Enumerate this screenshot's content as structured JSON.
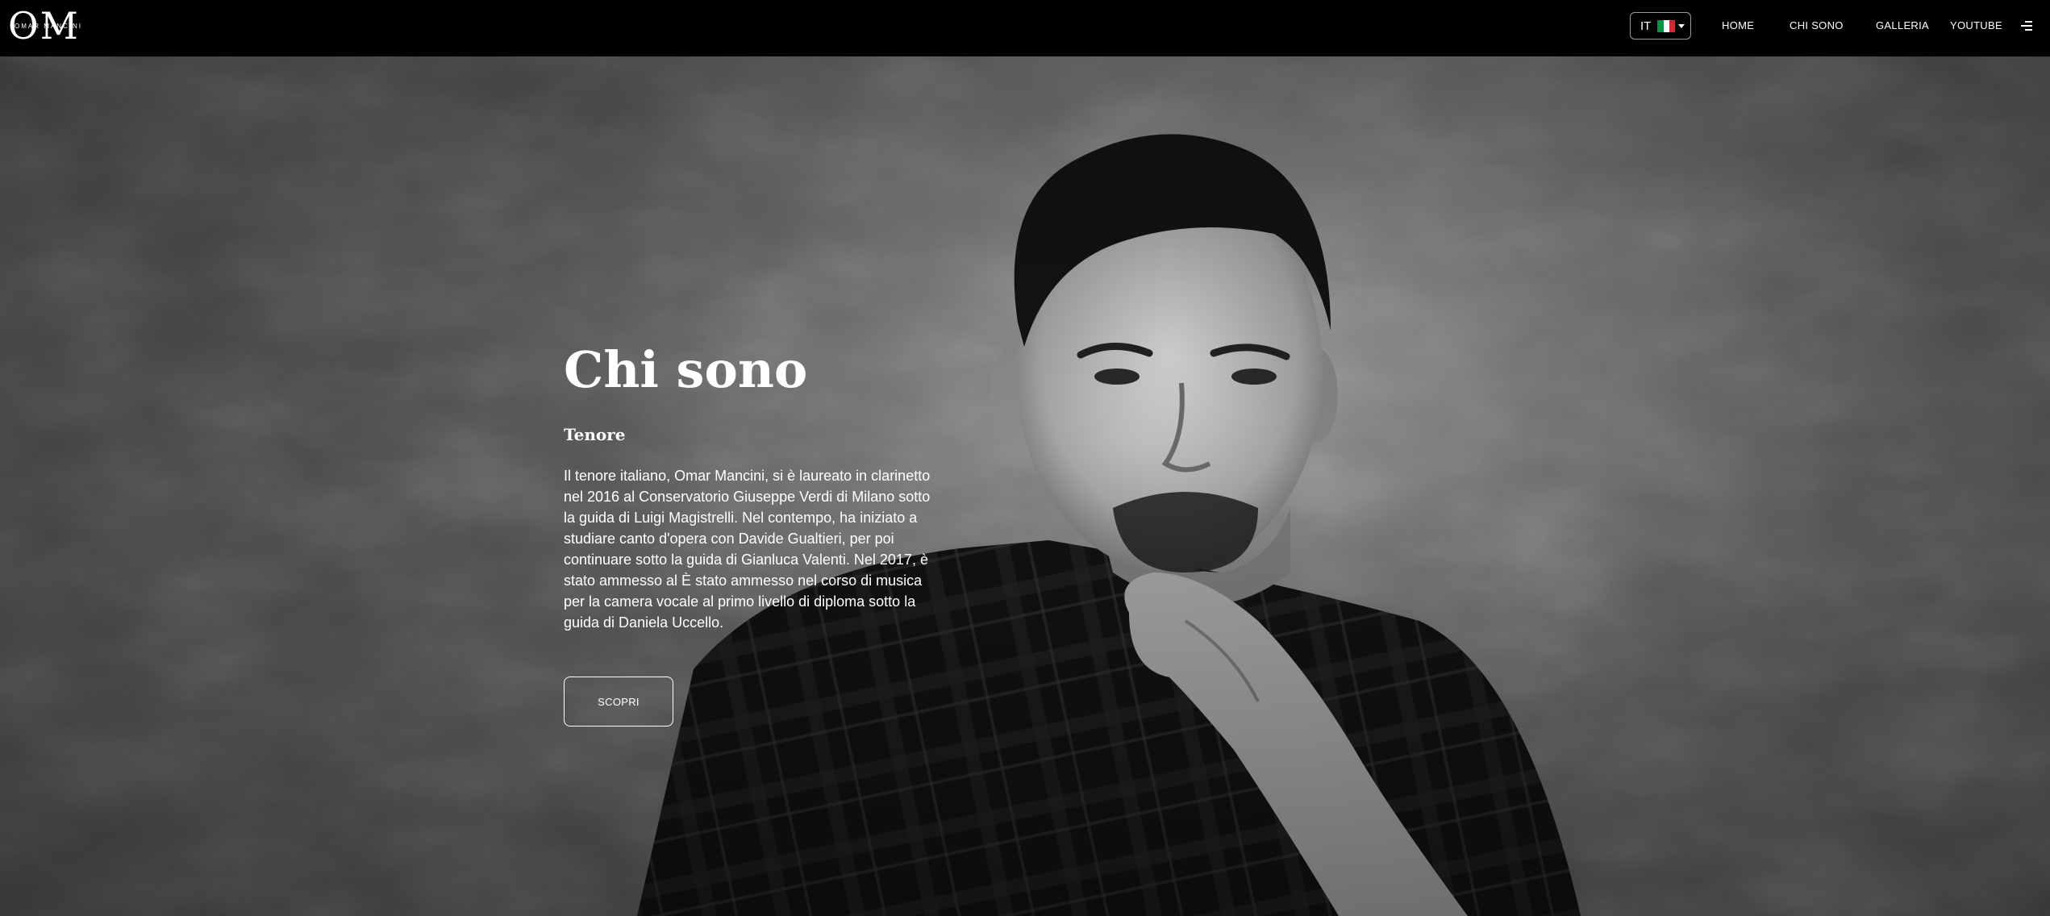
{
  "navbar": {
    "logo_text": "OM",
    "logo_subtext": "OMAR MANCINI",
    "language": {
      "code": "IT",
      "flag_colors": [
        "#009246",
        "#ffffff",
        "#ce2b37"
      ]
    },
    "links": [
      {
        "label": "HOME"
      },
      {
        "label": "CHI SONO"
      },
      {
        "label": "GALLERIA"
      },
      {
        "label": "YOUTUBE"
      }
    ],
    "menu_icon": "hamburger-icon"
  },
  "hero": {
    "title": "Chi sono",
    "subtitle": "Tenore",
    "body": "Il tenore italiano, Omar Mancini, si è laureato in clarinetto nel 2016 al Conservatorio Giuseppe Verdi di Milano sotto la guida di Luigi Magistrelli. Nel contempo, ha iniziato a studiare canto d'opera con Davide Gualtieri, per poi continuare sotto la guida di Gianluca Valenti. Nel 2017, è stato ammesso al È stato ammesso nel corso di musica per la camera vocale al primo livello di diploma sotto la guida di Daniela Uccello.",
    "cta_label": "SCOPRI"
  },
  "colors": {
    "navbar_bg": "#000000",
    "text": "#ffffff"
  }
}
